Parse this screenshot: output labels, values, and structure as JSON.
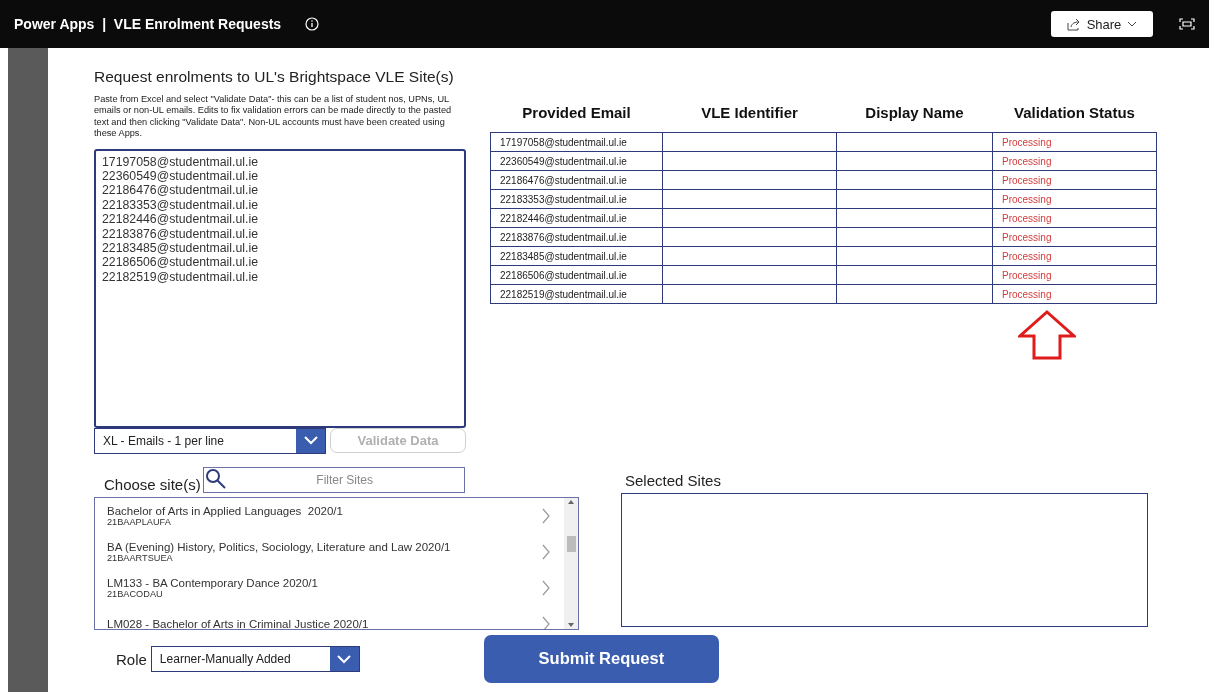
{
  "app_bar": {
    "app_name": "Power Apps",
    "separator": "|",
    "title": "VLE Enrolment Requests",
    "share_label": "Share"
  },
  "request_panel": {
    "heading": "Request enrolments to UL's Brightspace VLE Site(s)",
    "instructions": "Paste from Excel and select \"Validate Data\"- this can be a list of student nos, UPNs, UL emails or non-UL emails. Edits to fix validation errors can be made directly to the pasted text and then clicking \"Validate Data\". Non-UL accounts must have been created using these Apps.",
    "paste_box": {
      "value": [
        "17197058@studentmail.ul.ie",
        "22360549@studentmail.ul.ie",
        "22186476@studentmail.ul.ie",
        "22183353@studentmail.ul.ie",
        "22182446@studentmail.ul.ie",
        "22183876@studentmail.ul.ie",
        "22183485@studentmail.ul.ie",
        "22186506@studentmail.ul.ie",
        "22182519@studentmail.ul.ie"
      ]
    },
    "format_dropdown": {
      "value": "XL - Emails - 1 per line"
    },
    "validate_button": {
      "label": "Validate Data",
      "disabled": true
    }
  },
  "table": {
    "columns": [
      "Provided Email",
      "VLE Identifier",
      "Display Name",
      "Validation Status"
    ],
    "rows": [
      [
        "17197058@studentmail.ul.ie",
        "",
        "",
        "Processing"
      ],
      [
        "22360549@studentmail.ul.ie",
        "",
        "",
        "Processing"
      ],
      [
        "22186476@studentmail.ul.ie",
        "",
        "",
        "Processing"
      ],
      [
        "22183353@studentmail.ul.ie",
        "",
        "",
        "Processing"
      ],
      [
        "22182446@studentmail.ul.ie",
        "",
        "",
        "Processing"
      ],
      [
        "22183876@studentmail.ul.ie",
        "",
        "",
        "Processing"
      ],
      [
        "22183485@studentmail.ul.ie",
        "",
        "",
        "Processing"
      ],
      [
        "22186506@studentmail.ul.ie",
        "",
        "",
        "Processing"
      ],
      [
        "22182519@studentmail.ul.ie",
        "",
        "",
        "Processing"
      ]
    ]
  },
  "sites": {
    "label": "Choose site(s)",
    "filter_placeholder": "Filter Sites",
    "items": [
      {
        "name": "Bachelor of Arts in Applied Languages  2020/1",
        "code": "21BAAPLAUFA"
      },
      {
        "name": "BA (Evening) History, Politics, Sociology, Literature and Law 2020/1",
        "code": "21BAARTSUEA"
      },
      {
        "name": "LM133 - BA Contemporary Dance 2020/1",
        "code": "21BACODAU"
      },
      {
        "name": "LM028 - Bachelor of Arts in Criminal Justice 2020/1"
      }
    ]
  },
  "selected_sites": {
    "label": "Selected Sites"
  },
  "role": {
    "label": "Role",
    "value": "Learner-Manually Added"
  },
  "submit_button": {
    "label": "Submit Request"
  }
}
